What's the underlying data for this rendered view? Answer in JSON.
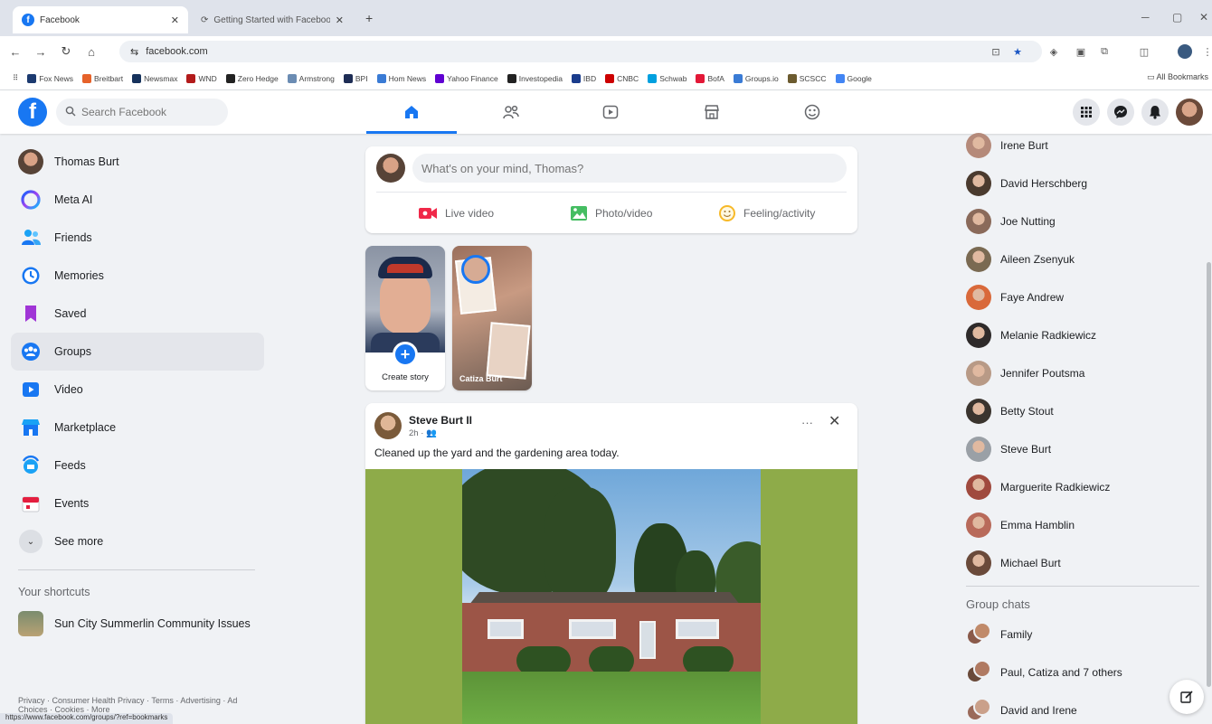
{
  "browser": {
    "tabs": [
      {
        "title": "Facebook",
        "active": true
      },
      {
        "title": "Getting Started with Facebook",
        "active": false
      }
    ],
    "url": "facebook.com",
    "bookmarks": [
      {
        "label": "Fox News",
        "color": "#1c3a70"
      },
      {
        "label": "Breitbart",
        "color": "#e6622a"
      },
      {
        "label": "Newsmax",
        "color": "#16325c"
      },
      {
        "label": "WND",
        "color": "#b31b1b"
      },
      {
        "label": "Zero Hedge",
        "color": "#222222"
      },
      {
        "label": "Armstrong",
        "color": "#6b8cb3"
      },
      {
        "label": "BPI",
        "color": "#1e2d55"
      },
      {
        "label": "Hom News",
        "color": "#3a7bd5"
      },
      {
        "label": "Yahoo Finance",
        "color": "#6001d2"
      },
      {
        "label": "Investopedia",
        "color": "#222222"
      },
      {
        "label": "IBD",
        "color": "#1a3c8c"
      },
      {
        "label": "CNBC",
        "color": "#cc0000"
      },
      {
        "label": "Schwab",
        "color": "#00a0df"
      },
      {
        "label": "BofA",
        "color": "#e31837"
      },
      {
        "label": "Groups.io",
        "color": "#3a7bd5"
      },
      {
        "label": "SCSCC",
        "color": "#6c5b2f"
      },
      {
        "label": "Google",
        "color": "#4285f4"
      }
    ],
    "all_bookmarks": "All Bookmarks",
    "status_url": "https://www.facebook.com/groups/?ref=bookmarks"
  },
  "header": {
    "logo": "f",
    "search_placeholder": "Search Facebook"
  },
  "left": {
    "user": "Thomas Burt",
    "items": [
      {
        "label": "Meta AI"
      },
      {
        "label": "Friends"
      },
      {
        "label": "Memories"
      },
      {
        "label": "Saved"
      },
      {
        "label": "Groups"
      },
      {
        "label": "Video"
      },
      {
        "label": "Marketplace"
      },
      {
        "label": "Feeds"
      },
      {
        "label": "Events"
      }
    ],
    "see_more": "See more",
    "shortcuts_title": "Your shortcuts",
    "shortcuts": [
      {
        "label": "Sun City Summerlin Community Issues"
      }
    ],
    "footer": "Privacy · Consumer Health Privacy · Terms · Advertising · Ad Choices · Cookies · More"
  },
  "composer": {
    "placeholder": "What's on your mind, Thomas?",
    "live_video": "Live video",
    "photo_video": "Photo/video",
    "feeling": "Feeling/activity"
  },
  "stories": {
    "create_label": "Create story",
    "friend_name": "Catiza Burt"
  },
  "post": {
    "author": "Steve Burt II",
    "time": "2h ·",
    "text": "Cleaned up the yard and the gardening area today.",
    "more": "···",
    "close": "✕"
  },
  "right": {
    "contacts": [
      {
        "name": "Irene Burt",
        "color": "#b58a7a"
      },
      {
        "name": "David Herschberg",
        "color": "#4a3a2e"
      },
      {
        "name": "Joe Nutting",
        "color": "#8a6a5a"
      },
      {
        "name": "Aileen Zsenyuk",
        "color": "#7a6a52"
      },
      {
        "name": "Faye Andrew",
        "color": "#d9693a"
      },
      {
        "name": "Melanie Radkiewicz",
        "color": "#2e2a2a"
      },
      {
        "name": "Jennifer Poutsma",
        "color": "#b89a86"
      },
      {
        "name": "Betty Stout",
        "color": "#3a342e"
      },
      {
        "name": "Steve Burt",
        "color": "#9aa0a6"
      },
      {
        "name": "Marguerite Radkiewicz",
        "color": "#a04a3e"
      },
      {
        "name": "Emma Hamblin",
        "color": "#b86a5a"
      },
      {
        "name": "Michael Burt",
        "color": "#6a4a3a"
      }
    ],
    "group_chats_title": "Group chats",
    "group_chats": [
      {
        "name": "Family"
      },
      {
        "name": "Paul, Catiza and 7 others"
      },
      {
        "name": "David and Irene"
      }
    ]
  }
}
